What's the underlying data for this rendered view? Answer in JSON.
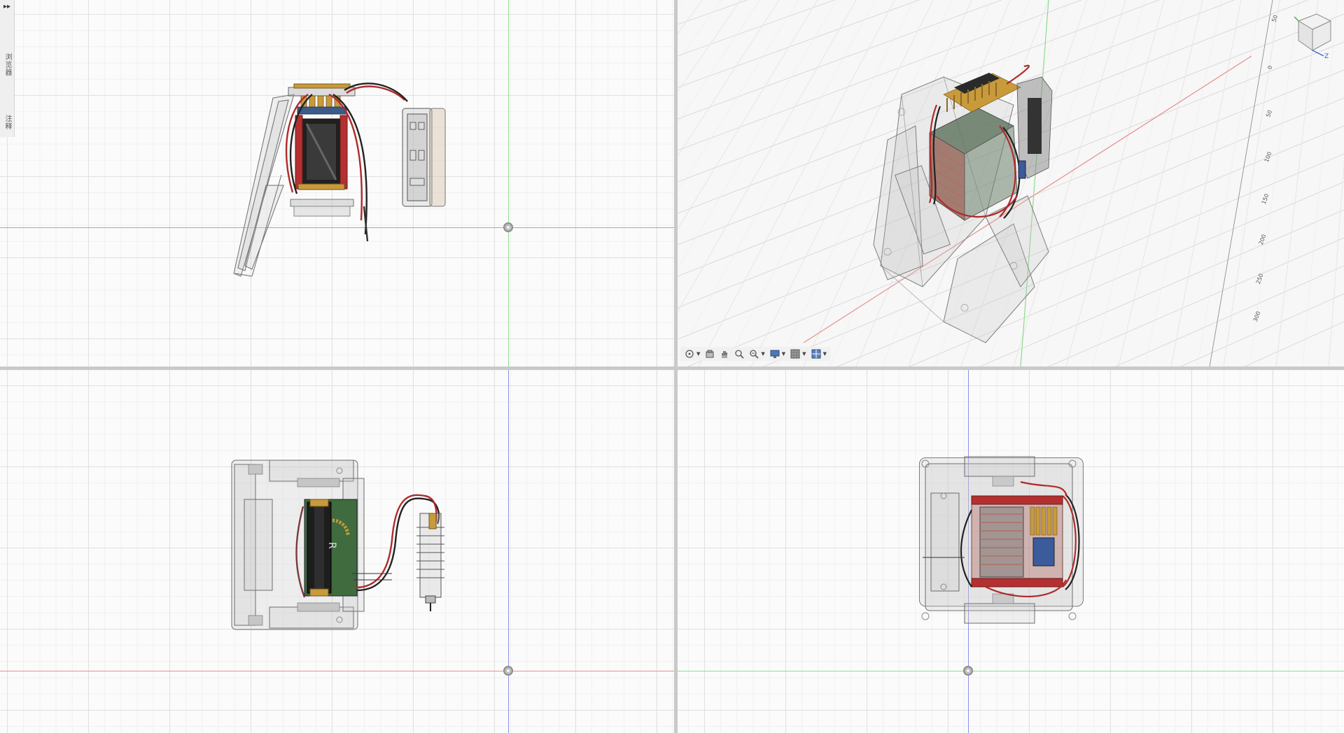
{
  "side_panel": {
    "expand_glyph": "▸▸",
    "tabs": [
      {
        "label": "浏览器"
      },
      {
        "label": "注释"
      }
    ]
  },
  "viewports": {
    "top_left": {
      "name": "front-view"
    },
    "top_right": {
      "name": "perspective-view"
    },
    "bottom_left": {
      "name": "top-view"
    },
    "bottom_right": {
      "name": "right-view"
    }
  },
  "toolbar": {
    "buttons": [
      {
        "name": "orbit-icon",
        "has_dropdown": true
      },
      {
        "name": "look-at-icon",
        "has_dropdown": false
      },
      {
        "name": "pan-icon",
        "has_dropdown": false
      },
      {
        "name": "zoom-icon",
        "has_dropdown": false
      },
      {
        "name": "fit-zoom-icon",
        "has_dropdown": true
      },
      {
        "name": "display-settings-icon",
        "has_dropdown": true
      },
      {
        "name": "grid-snaps-icon",
        "has_dropdown": true
      },
      {
        "name": "viewports-icon",
        "has_dropdown": true
      }
    ]
  },
  "viewcube": {
    "axis_label": "Z"
  },
  "ruler": {
    "ticks": [
      "50",
      "0",
      "50",
      "100",
      "150",
      "200",
      "250",
      "300"
    ]
  },
  "colors": {
    "x_axis": "#e06b6b",
    "y_axis": "#6bd36b",
    "z_axis": "#6b6be0",
    "wire_red": "#b02a2a",
    "connector_gold": "#c89a3a",
    "pcb_green": "#3f6b3f"
  }
}
